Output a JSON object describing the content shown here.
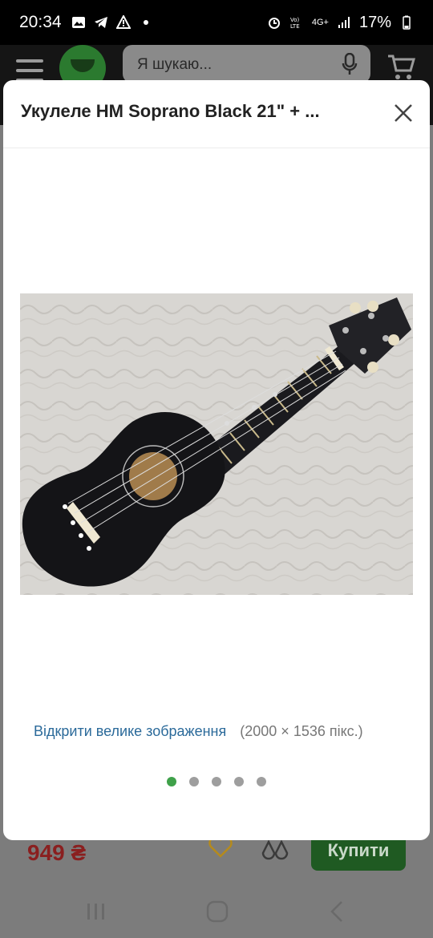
{
  "status_bar": {
    "time": "20:34",
    "network": "4G+",
    "battery": "17%"
  },
  "background_page": {
    "search_placeholder": "Я шукаю...",
    "price": "949 ₴",
    "buy_label": "Купити"
  },
  "modal": {
    "title": "Укулеле HM Soprano Black 21\" + ...",
    "open_large_link": "Відкрити велике зображення",
    "image_size": "(2000 × 1536 пікс.)",
    "pagination": {
      "total": 5,
      "active": 1
    }
  },
  "colors": {
    "accent_green": "#3fa14a",
    "link_blue": "#2b6a9a",
    "price_red": "#8a1f1f"
  }
}
